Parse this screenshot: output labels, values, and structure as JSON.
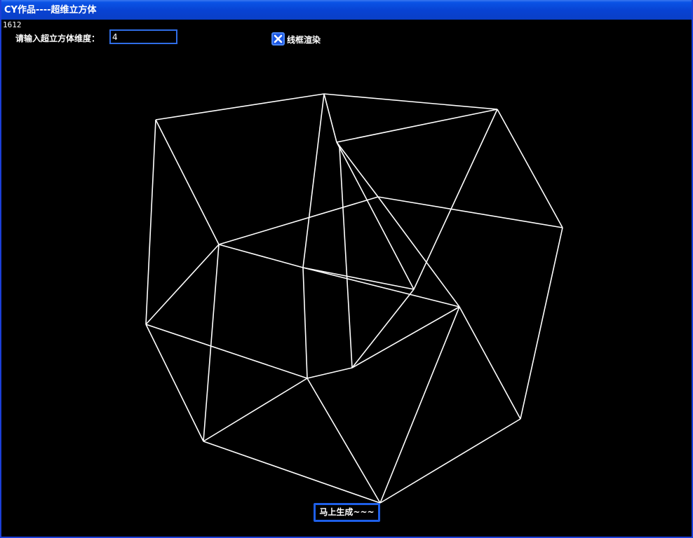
{
  "window": {
    "title": "CY作品----超维立方体"
  },
  "overlay": {
    "fps_counter": "1612",
    "dimension_label": "请输入超立方体维度：",
    "dimension_value": "4",
    "wireframe_label": "线框渲染",
    "wireframe_checked": true,
    "generate_button": "马上生成~~~"
  },
  "render": {
    "line_color": "#ffffff",
    "background": "#000000",
    "dimension": 4
  },
  "colors": {
    "title_bar": "#0a46d8",
    "control_border": "#2f6de6",
    "checkbox_fill": "#1b57e4"
  }
}
